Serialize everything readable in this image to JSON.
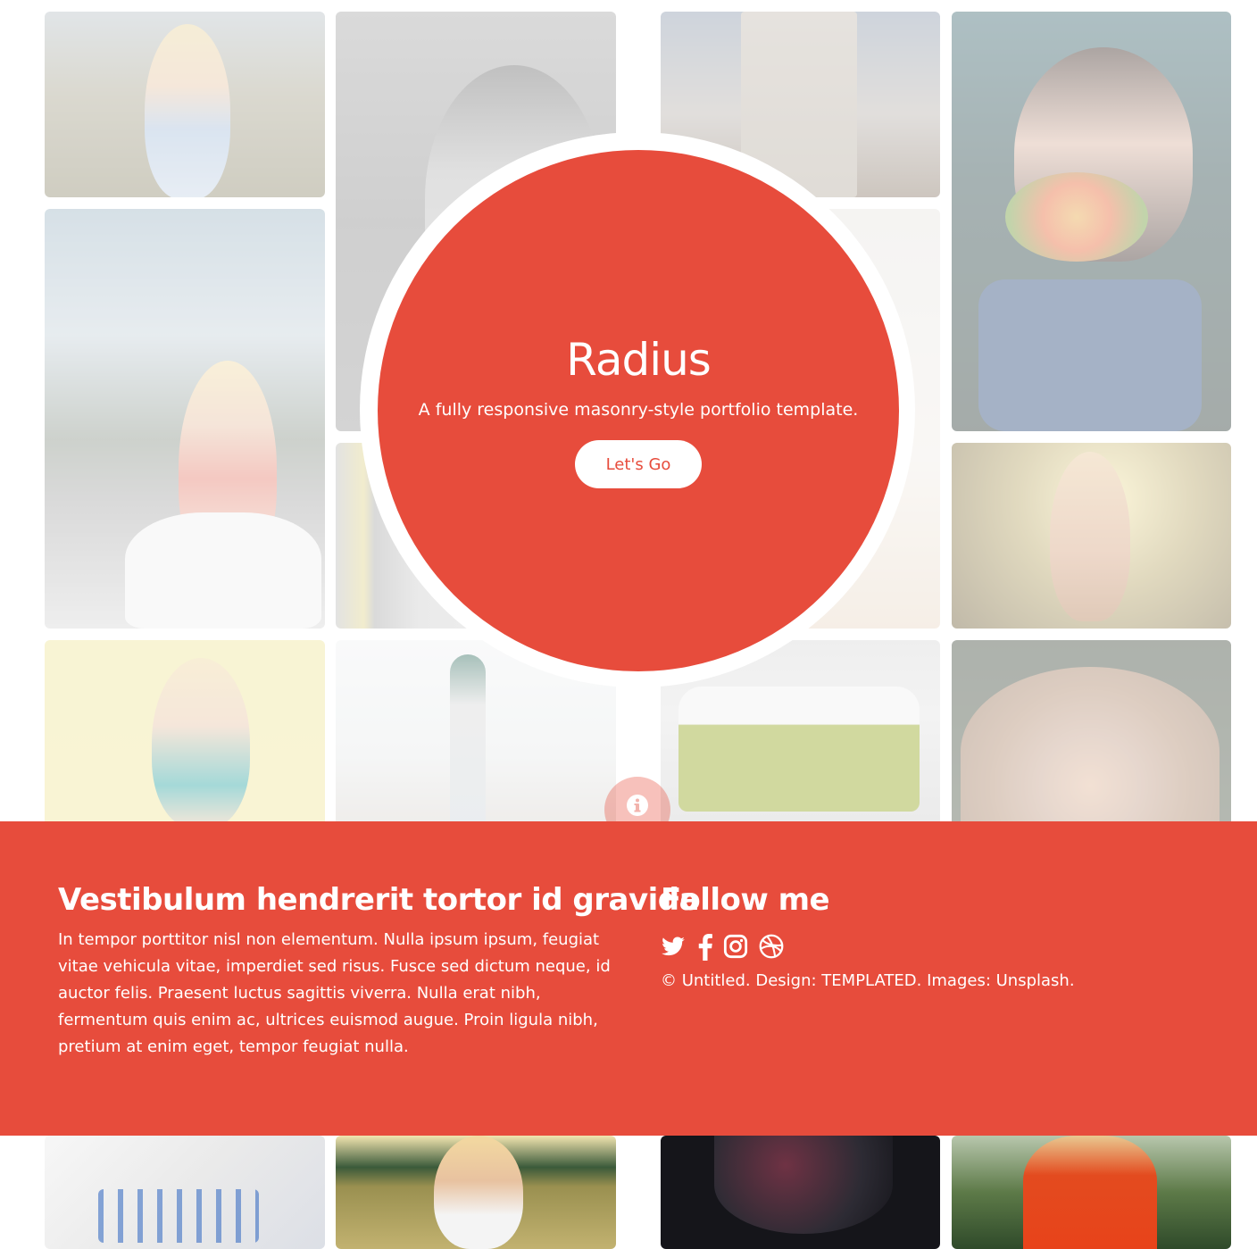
{
  "hero": {
    "title": "Radius",
    "subtitle": "A fully responsive masonry-style portfolio template.",
    "button_label": "Let's Go"
  },
  "footer": {
    "about_heading": "Vestibulum hendrerit tortor id gravida",
    "about_text": "In tempor porttitor nisl non elementum. Nulla ipsum ipsum, feugiat vitae vehicula vitae, imperdiet sed risus. Fusce sed dictum neque, id auctor felis. Praesent luctus sagittis viverra. Nulla erat nibh, fermentum quis enim ac, ultrices euismod augue. Proin ligula nibh, pretium at enim eget, tempor feugiat nulla.",
    "follow_heading": "Follow me",
    "social_icons": [
      "twitter-icon",
      "facebook-icon",
      "instagram-icon",
      "dribbble-icon"
    ],
    "copyright": "© Untitled. Design: TEMPLATED. Images: Unsplash."
  },
  "colors": {
    "accent": "#e74c3c",
    "text_on_accent": "#ffffff"
  }
}
